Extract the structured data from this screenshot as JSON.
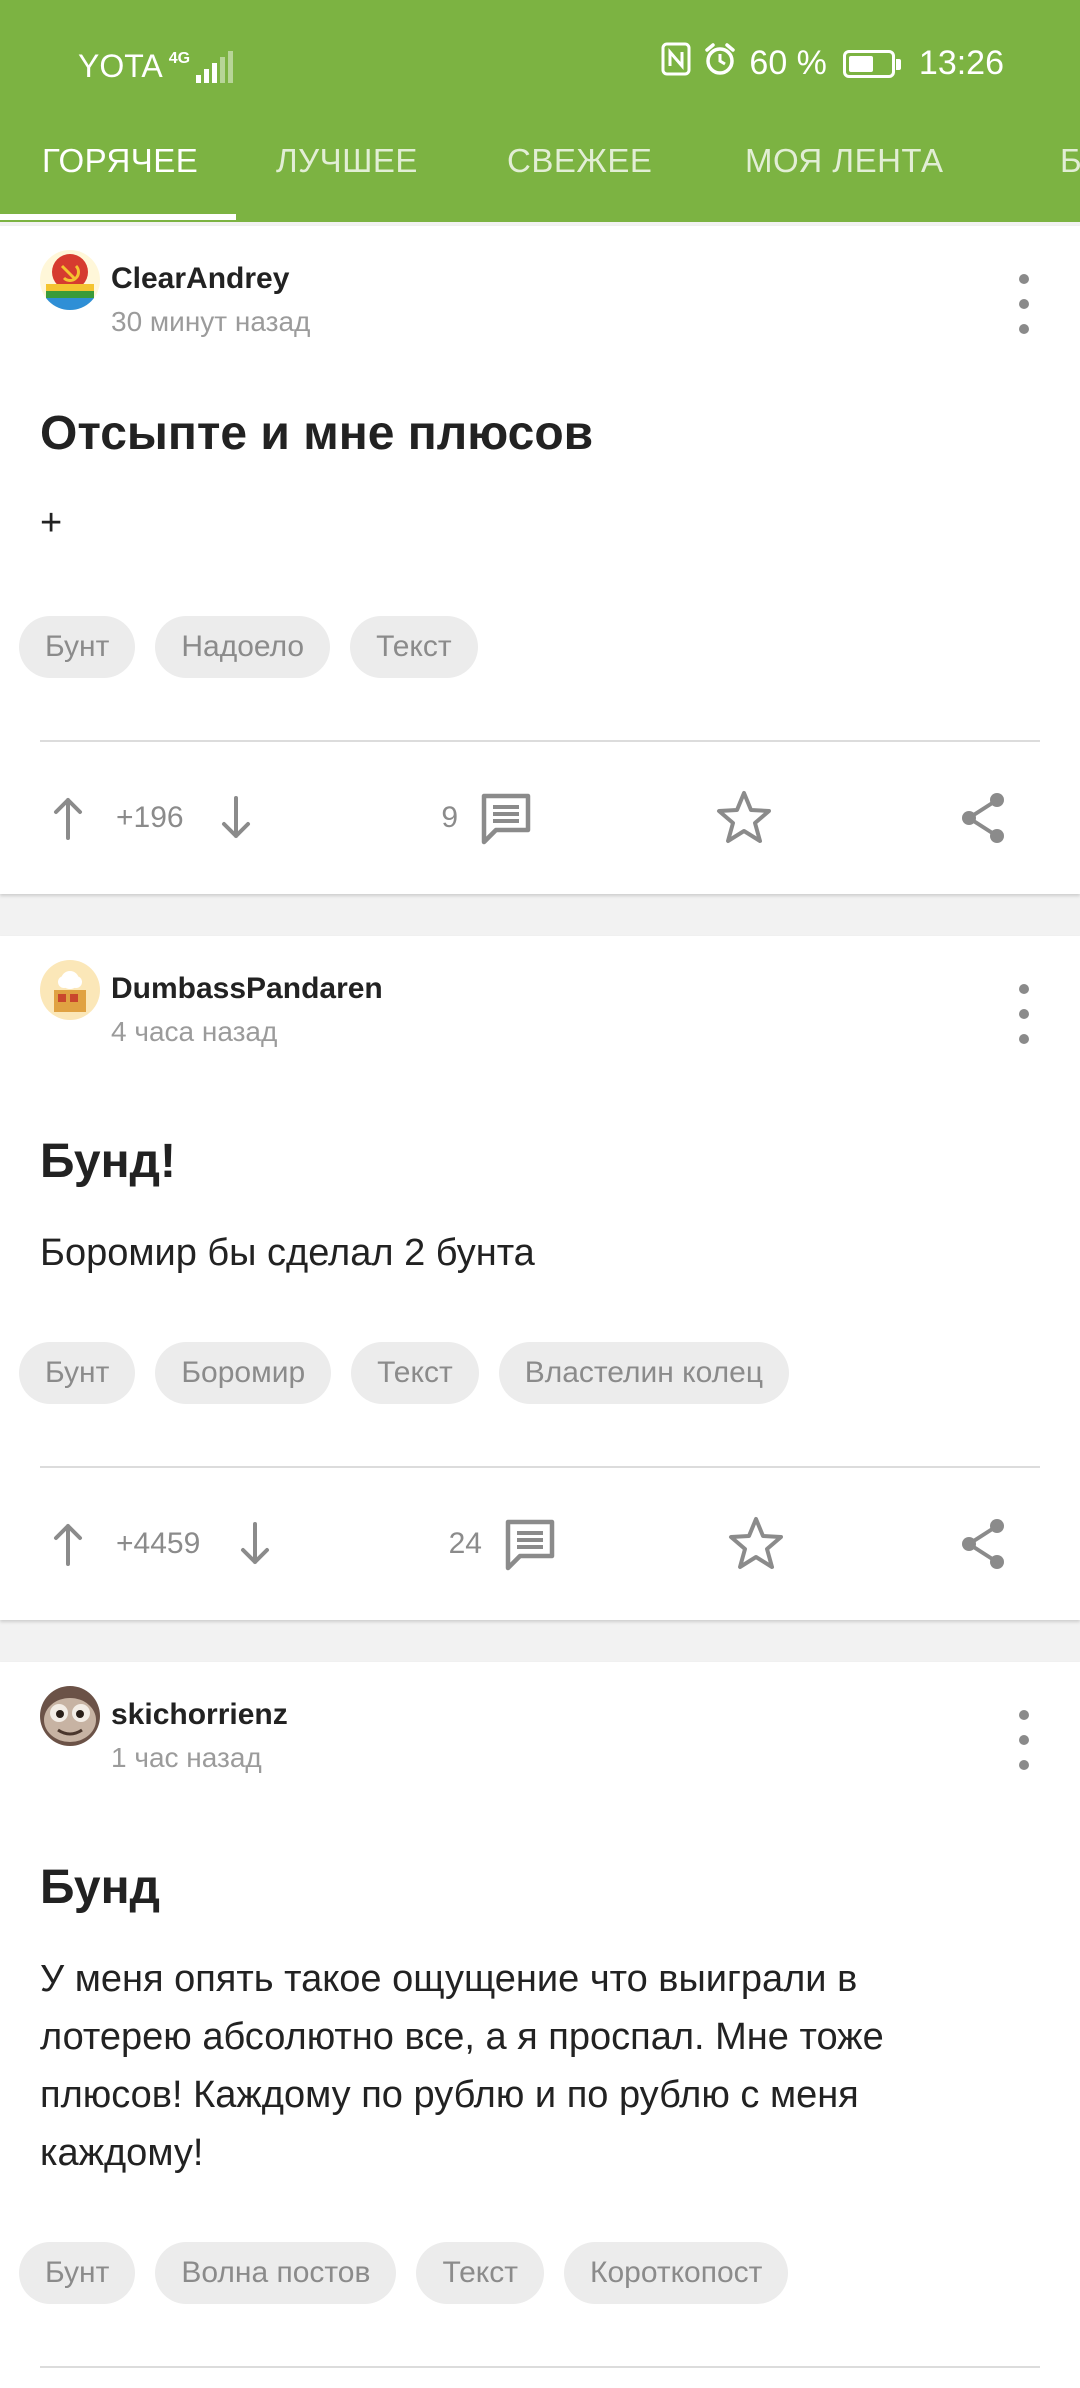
{
  "status": {
    "carrier": "YOTA",
    "network": "4G",
    "battery_percent": "60 %",
    "battery_level": 0.6,
    "time": "13:26"
  },
  "tabs": [
    {
      "label": "ГОРЯЧЕЕ",
      "active": true
    },
    {
      "label": "ЛУЧШЕЕ",
      "active": false
    },
    {
      "label": "СВЕЖЕЕ",
      "active": false
    },
    {
      "label": "МОЯ ЛЕНТА",
      "active": false
    },
    {
      "label": "Б",
      "active": false
    }
  ],
  "posts": [
    {
      "author": "ClearAndrey",
      "time": "30 минут назад",
      "title": "Отсыпте и мне плюсов",
      "text": "+",
      "tags": [
        "Бунт",
        "Надоело",
        "Текст"
      ],
      "rating": "+196",
      "comments": "9"
    },
    {
      "author": "DumbassPandaren",
      "time": "4 часа назад",
      "title": "Бунд!",
      "text": "Боромир бы сделал 2 бунта",
      "tags": [
        "Бунт",
        "Боромир",
        "Текст",
        "Властелин колец"
      ],
      "rating": "+4459",
      "comments": "24"
    },
    {
      "author": "skichorrienz",
      "time": "1 час назад",
      "title": "Бунд",
      "text": "У меня опять такое ощущение что выиграли в лотерею абсолютно все, а я проспал. Мне тоже плюсов! Каждому по рублю и по рублю с меня каждому!",
      "tags": [
        "Бунт",
        "Волна постов",
        "Текст",
        "Короткопост"
      ]
    }
  ],
  "colors": {
    "brand": "#7cb342",
    "icon": "#8b8b8b",
    "tag_bg": "#ececec"
  },
  "icons": {
    "upvote": "arrow-up-icon",
    "downvote": "arrow-down-icon",
    "comments": "comment-icon",
    "save": "star-icon",
    "share": "share-icon",
    "more": "more-vertical-icon"
  }
}
